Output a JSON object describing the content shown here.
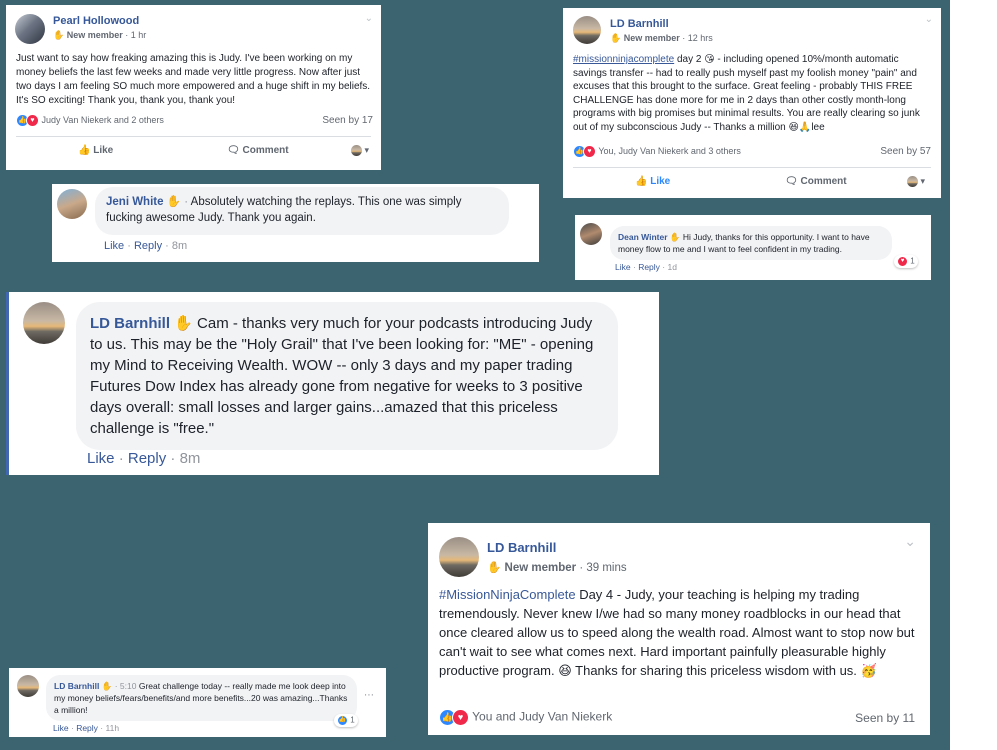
{
  "colors": {
    "background": "#3c6470",
    "name_blue": "#365899",
    "like_blue": "#2d88ff",
    "love_red": "#f0284a"
  },
  "post_pearl": {
    "author": "Pearl Hollowood",
    "badge": "New member",
    "time": "· 1 hr",
    "text": "Just want to say how freaking amazing this is Judy. I've been working on my money beliefs the last few weeks and made very little progress. Now after just two days I am feeling SO much more empowered and a huge shift in my beliefs. It's SO exciting! Thank you, thank you, thank you!",
    "reactions": "Judy Van Niekerk and 2 others",
    "seen": "Seen by 17",
    "like_label": "Like",
    "comment_label": "Comment"
  },
  "post_ld_top": {
    "author": "LD Barnhill",
    "badge": "New member",
    "time": "· 12 hrs",
    "hashtag": "#missionninjacomplete",
    "text": "day 2 😘 - including opened 10%/month automatic savings transfer -- had to really push myself past my foolish money \"pain\" and excuses that this brought to the surface. Great feeling - probably THIS FREE CHALLENGE has done more for me in 2 days than other costly month-long programs with big promises but minimal results. You are really clearing so junk out of my subconscious Judy -- Thanks a million 😆🙏lee",
    "reactions": "You, Judy Van Niekerk and 3 others",
    "seen": "Seen by 57",
    "like_label": "Like",
    "comment_label": "Comment"
  },
  "comment_jeni": {
    "author": "Jeni White",
    "text": "Absolutely watching the replays. This one was simply fucking awesome Judy. Thank you again.",
    "like": "Like",
    "reply": "Reply",
    "time": "8m"
  },
  "comment_dean": {
    "author": "Dean Winter",
    "text": "Hi Judy, thanks for this opportunity. I want to have money flow to me and I want to feel confident in my trading.",
    "like": "Like",
    "reply": "Reply",
    "time": "1d",
    "reaction_count": "1"
  },
  "comment_ld_big": {
    "author": "LD Barnhill",
    "text": "Cam - thanks very much for your podcasts introducing Judy to us. This may be the \"Holy Grail\" that I've been looking for: \"ME\" - opening my Mind to Receiving Wealth. WOW -- only 3 days and my paper trading Futures Dow Index has already gone from negative for weeks to 3 positive days overall: small losses and larger gains...amazed that this priceless challenge is \"free.\"",
    "like": "Like",
    "reply": "Reply",
    "time": "8m"
  },
  "comment_ld_small": {
    "author": "LD Barnhill",
    "time_prefix": "5:10",
    "text": "Great challenge today -- really made me look deep into my money beliefs/fears/benefits/and more benefits...20 was amazing...Thanks a million!",
    "like": "Like",
    "reply": "Reply",
    "time": "11h",
    "reaction_count": "1"
  },
  "post_ld_bottom": {
    "author": "LD Barnhill",
    "badge": "New member",
    "time": "· 39 mins",
    "hashtag": "#MissionNinjaComplete",
    "text": "Day 4 - Judy, your teaching is helping my trading tremendously. Never knew I/we had so many money roadblocks in our head that once cleared allow us to speed along the wealth road. Almost want to stop now but can't wait to see what comes next. Hard important painfully pleasurable highly productive program. 😆 Thanks for sharing this priceless wisdom with us. 🥳",
    "reactions": "You and Judy Van Niekerk",
    "seen": "Seen by 11"
  }
}
